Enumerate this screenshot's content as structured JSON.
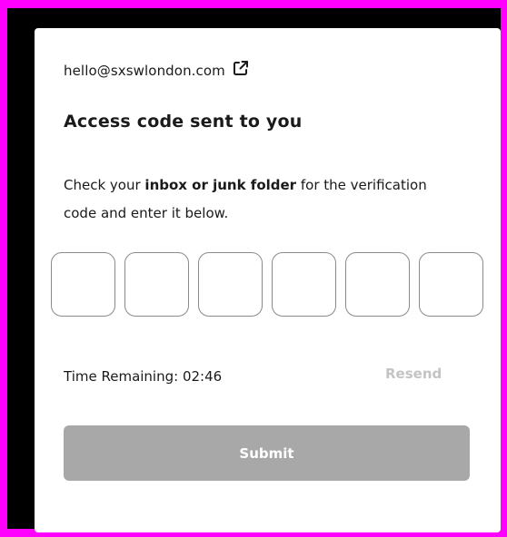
{
  "account": {
    "email": "hello@sxswlondon.com",
    "external_link_icon": "external-link-icon"
  },
  "heading": {
    "title": "Access code sent to you"
  },
  "instructions": {
    "prefix": "Check your ",
    "emphasis": "inbox or junk folder",
    "suffix": " for the verification code and enter it below."
  },
  "code_inputs": {
    "count": 6,
    "values": [
      "",
      "",
      "",
      "",
      "",
      ""
    ]
  },
  "timer": {
    "label": "Time Remaining: 02:46"
  },
  "actions": {
    "resend_label": "Resend",
    "submit_label": "Submit"
  },
  "colors": {
    "frame_border": "#ff00ff",
    "background": "#000000",
    "card": "#ffffff",
    "submit_disabled": "#a8a8a8",
    "resend_disabled": "#c4c4c4"
  }
}
